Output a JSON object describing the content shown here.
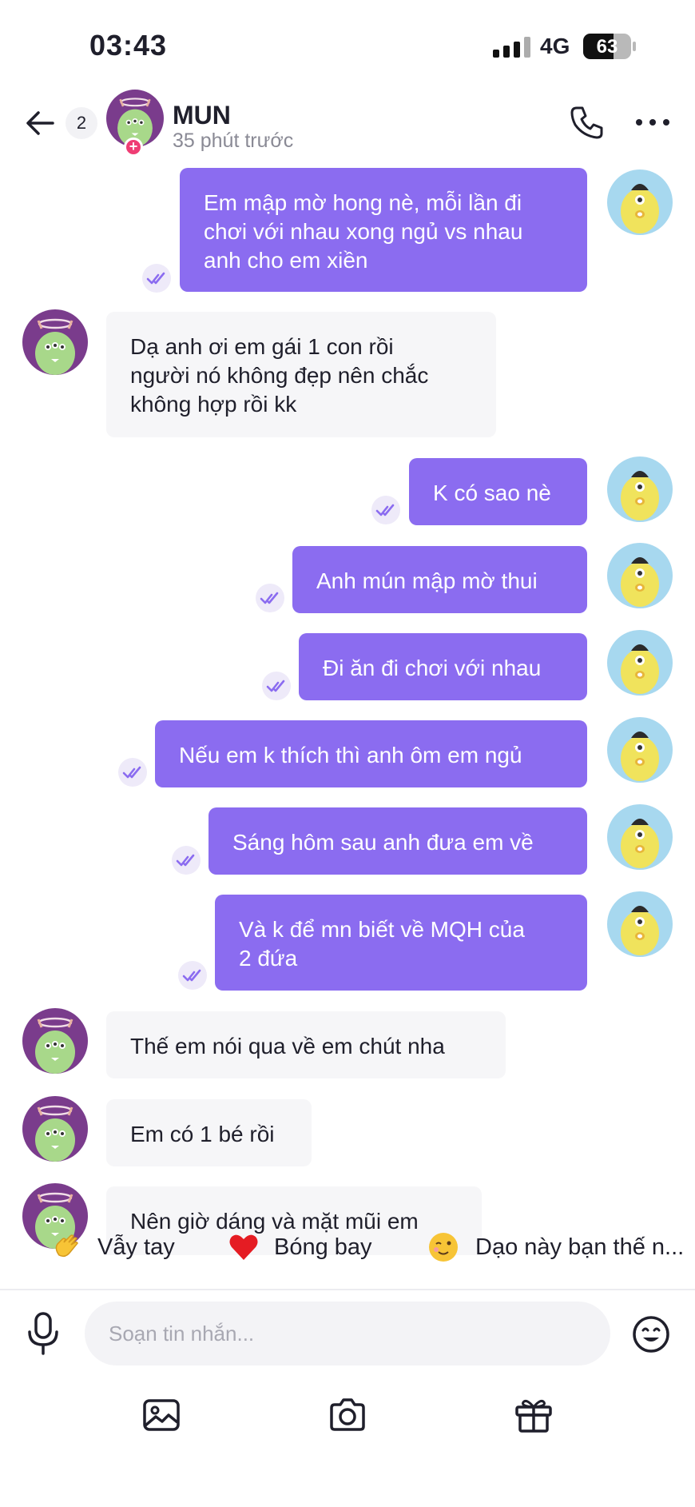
{
  "status_bar": {
    "time": "03:43",
    "network": "4G",
    "battery_percent": 63,
    "battery": "63"
  },
  "header": {
    "unread_count": "2",
    "name": "MUN",
    "last_seen": "35 phút trước"
  },
  "messages": [
    {
      "dir": "out",
      "lines": [
        "Em mập mờ hong nè, mỗi lần đi",
        "chơi với nhau xong ngủ vs nhau",
        "anh cho em xiền"
      ]
    },
    {
      "dir": "in",
      "lines": [
        "Dạ anh ơi em gái 1 con rồi",
        "người nó không đẹp nên chắc",
        "không hợp rồi kk"
      ]
    },
    {
      "dir": "out",
      "lines": [
        "K có sao nè"
      ]
    },
    {
      "dir": "out",
      "lines": [
        "Anh mún mập mờ thui"
      ]
    },
    {
      "dir": "out",
      "lines": [
        "Đi ăn đi chơi với nhau"
      ]
    },
    {
      "dir": "out",
      "lines": [
        "Nếu em k thích thì anh ôm em ngủ"
      ]
    },
    {
      "dir": "out",
      "lines": [
        "Sáng hôm sau anh đưa em về"
      ]
    },
    {
      "dir": "out",
      "lines": [
        "Và k để mn biết về MQH của",
        "2 đứa"
      ]
    },
    {
      "dir": "in",
      "lines": [
        "Thế em nói qua về em chút nha"
      ]
    },
    {
      "dir": "in",
      "lines": [
        "Em có 1 bé rồi"
      ]
    },
    {
      "dir": "in",
      "lines": [
        "Nên giờ dáng và mặt mũi em"
      ]
    }
  ],
  "quick_replies": [
    {
      "icon": "waving-hand-icon",
      "label": "Vẫy tay"
    },
    {
      "icon": "heart-icon",
      "label": "Bóng bay"
    },
    {
      "icon": "winking-face-icon",
      "label": "Dạo này bạn thế n..."
    }
  ],
  "composer": {
    "placeholder": "Soạn tin nhắn..."
  },
  "toolbar": [
    "image-icon",
    "camera-icon",
    "gift-icon"
  ],
  "colors": {
    "outgoing_bubble": "#8b6cf0",
    "incoming_bubble": "#f6f6f8",
    "accent": "#8b6cf0"
  }
}
